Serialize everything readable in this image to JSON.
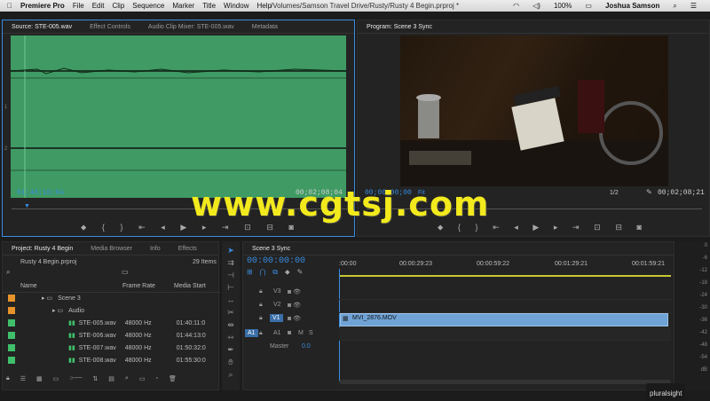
{
  "menubar": {
    "app": "Premiere Pro",
    "items": [
      "File",
      "Edit",
      "Clip",
      "Sequence",
      "Marker",
      "Title",
      "Window",
      "Help"
    ],
    "path": "/Volumes/Samson Travel Drive/Rusty/Rusty 4 Begin.prproj *",
    "battery": "100%",
    "user": "Joshua Samson"
  },
  "source": {
    "tabs": [
      "Source: STE-005.wav",
      "Effect Controls",
      "Audio Clip Mixer: STE-005.wav",
      "Metadata"
    ],
    "timecode_left": "01;40;16;04",
    "timecode_right": "00;02;08;04",
    "channel1": "1",
    "channel2": "2"
  },
  "program": {
    "tab": "Program: Scene 3 Sync",
    "timecode_left": "00;00;00;00",
    "fit": "Fit",
    "zoom": "1/2",
    "timecode_right": "00;02;08;21"
  },
  "project": {
    "tabs": [
      "Project: Rusty 4 Begin",
      "Media Browser",
      "Info",
      "Effects"
    ],
    "file": "Rusty 4 Begin.prproj",
    "count": "29 Items",
    "headers": {
      "name": "Name",
      "rate": "Frame Rate",
      "start": "Media Start"
    },
    "folder1": "Scene 3",
    "folder2": "Audio",
    "items": [
      {
        "name": "STE-005.wav",
        "rate": "48000 Hz",
        "start": "01:40:11:0"
      },
      {
        "name": "STE-006.wav",
        "rate": "48000 Hz",
        "start": "01:44:13:0"
      },
      {
        "name": "STE-007.wav",
        "rate": "48000 Hz",
        "start": "01:50:32:0"
      },
      {
        "name": "STE-008.wav",
        "rate": "48000 Hz",
        "start": "01:55:30:0"
      }
    ]
  },
  "timeline": {
    "tab": "Scene 3 Sync",
    "timecode": "00:00:00:00",
    "ruler": [
      ":00:00",
      "00:00:29:23",
      "00:00:59:22",
      "00:01:29:21",
      "00:01:59:21"
    ],
    "tracks": {
      "v3": "V3",
      "v2": "V2",
      "v1": "V1",
      "a1": "A1",
      "a1b": "A1",
      "m": "M",
      "s": "S",
      "master": "Master",
      "master_val": "0.0"
    },
    "clip": "MVI_2876.MOV"
  },
  "meter": [
    "0",
    "-6",
    "-12",
    "-18",
    "-24",
    "-30",
    "-36",
    "-42",
    "-48",
    "-54",
    "dB"
  ],
  "watermark": "www.cgtsj.com",
  "brand": "pluralsight",
  "colors": {
    "audio_bg": "#3f9a63",
    "clip_blue": "#6fa3d6",
    "accent": "#3a8dde"
  }
}
